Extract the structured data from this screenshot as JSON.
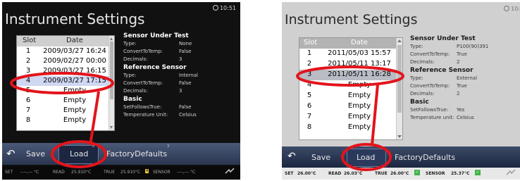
{
  "left": {
    "title": "Instrument Settings",
    "clock": "10:51",
    "list_headers": [
      "Slot",
      "Date"
    ],
    "rows": [
      {
        "slot": "1",
        "date": "2009/03/27 16:24"
      },
      {
        "slot": "2",
        "date": "2009/02/27 00:00"
      },
      {
        "slot": "3",
        "date": "2009/03/27 16:15"
      },
      {
        "slot": "4",
        "date": "2009/03/27 17:15"
      },
      {
        "slot": "5",
        "date": "Empty"
      },
      {
        "slot": "6",
        "date": "Empty"
      },
      {
        "slot": "7",
        "date": "Empty"
      },
      {
        "slot": "8",
        "date": "Empty"
      }
    ],
    "selected_slot": "4",
    "sections": [
      {
        "heading": "Sensor Under Test",
        "fields": [
          {
            "label": "Type:",
            "value": "None"
          },
          {
            "label": "ConvertToTemp:",
            "value": "False"
          },
          {
            "label": "Decimals:",
            "value": "3"
          }
        ]
      },
      {
        "heading": "Reference Sensor",
        "fields": [
          {
            "label": "Type:",
            "value": "Internal"
          },
          {
            "label": "ConvertToTemp:",
            "value": "False"
          },
          {
            "label": "Decimals:",
            "value": "3"
          }
        ]
      },
      {
        "heading": "Basic",
        "fields": [
          {
            "label": "SetFollowsTrue:",
            "value": "False"
          },
          {
            "label": "Temperature Unit:",
            "value": "Celsius"
          }
        ]
      }
    ],
    "toolbar": {
      "back": "↶",
      "save": "Save",
      "load": "Load",
      "factory": "FactoryDefaults",
      "load_num": "2",
      "factory_num": "3"
    },
    "status": {
      "set_label": "SET",
      "set_value": "----,--- °C",
      "read_label": "READ",
      "read_value": "25.910°C",
      "true_label": "TRUE",
      "true_value": "25.910°C",
      "badge": "4",
      "sensor_label": "SENSOR",
      "sensor_value": "----,--- °C"
    }
  },
  "right": {
    "title": "Instrument Settings",
    "clock": "10:",
    "list_headers": [
      "Slot",
      "Date"
    ],
    "rows": [
      {
        "slot": "1",
        "date": "2011/05/03 15:57"
      },
      {
        "slot": "2",
        "date": "2011/05/11 13:17"
      },
      {
        "slot": "3",
        "date": "2011/05/11 16:28"
      },
      {
        "slot": "4",
        "date": "Empty"
      },
      {
        "slot": "5",
        "date": "Empty"
      },
      {
        "slot": "6",
        "date": "Empty"
      },
      {
        "slot": "7",
        "date": "Empty"
      },
      {
        "slot": "8",
        "date": "Empty"
      }
    ],
    "selected_slot": "3",
    "sections": [
      {
        "heading": "Sensor Under Test",
        "fields": [
          {
            "label": "Type:",
            "value": "P100(90)391"
          },
          {
            "label": "ConvertToTemp:",
            "value": "True"
          },
          {
            "label": "Decimals:",
            "value": "2"
          }
        ]
      },
      {
        "heading": "Reference Sensor",
        "fields": [
          {
            "label": "Type:",
            "value": "External"
          },
          {
            "label": "ConvertToTemp:",
            "value": "True"
          },
          {
            "label": "Decimals:",
            "value": "2"
          }
        ]
      },
      {
        "heading": "Basic",
        "fields": [
          {
            "label": "SetFollowsTrue:",
            "value": "Yes"
          },
          {
            "label": "Temperature unit:",
            "value": "Celsius"
          }
        ]
      }
    ],
    "toolbar": {
      "back": "↶",
      "save": "Save",
      "load": "Load",
      "factory": "FactoryDefaults"
    },
    "status": {
      "set_label": "SET",
      "set_value": "26.00°C",
      "read_label": "READ",
      "read_value": "26.03°C",
      "true_label": "TRUE",
      "true_value": "26.00°C",
      "sensor_label": "SENSOR",
      "sensor_value": "25.37°C"
    }
  },
  "colors": {
    "callout": "#e2141c",
    "toolbar": "#2a3550",
    "check": "#3fb54a",
    "badge": "#e8c63c"
  }
}
